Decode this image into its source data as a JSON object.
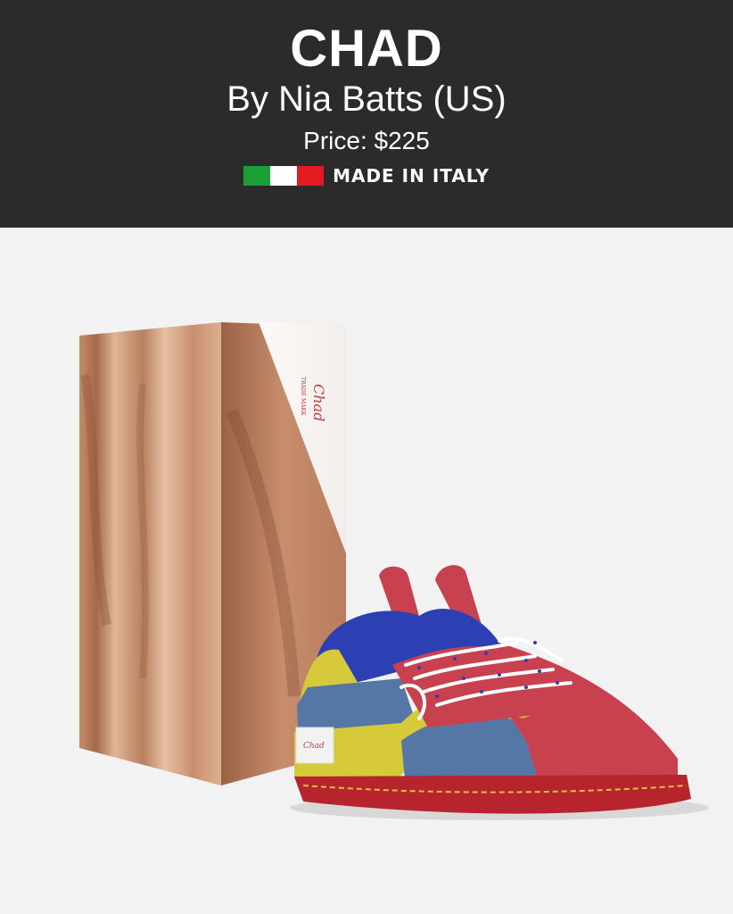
{
  "product": {
    "name": "CHAD",
    "designer": "By Nia Batts (US)",
    "price": "Price: $225",
    "origin": "MADE IN ITALY",
    "flag_colors": [
      "#1aa032",
      "#ffffff",
      "#e21b22"
    ],
    "box_logo_text": "Chad",
    "box_small_text": "TRADE MARK"
  },
  "colors": {
    "header_bg": "#2b2b2b",
    "page_bg": "#f2f2f2",
    "shoe_red": "#c8414f",
    "shoe_blue": "#5577a6",
    "shoe_royal": "#2c3fb3",
    "shoe_yellow": "#d6c93a"
  }
}
